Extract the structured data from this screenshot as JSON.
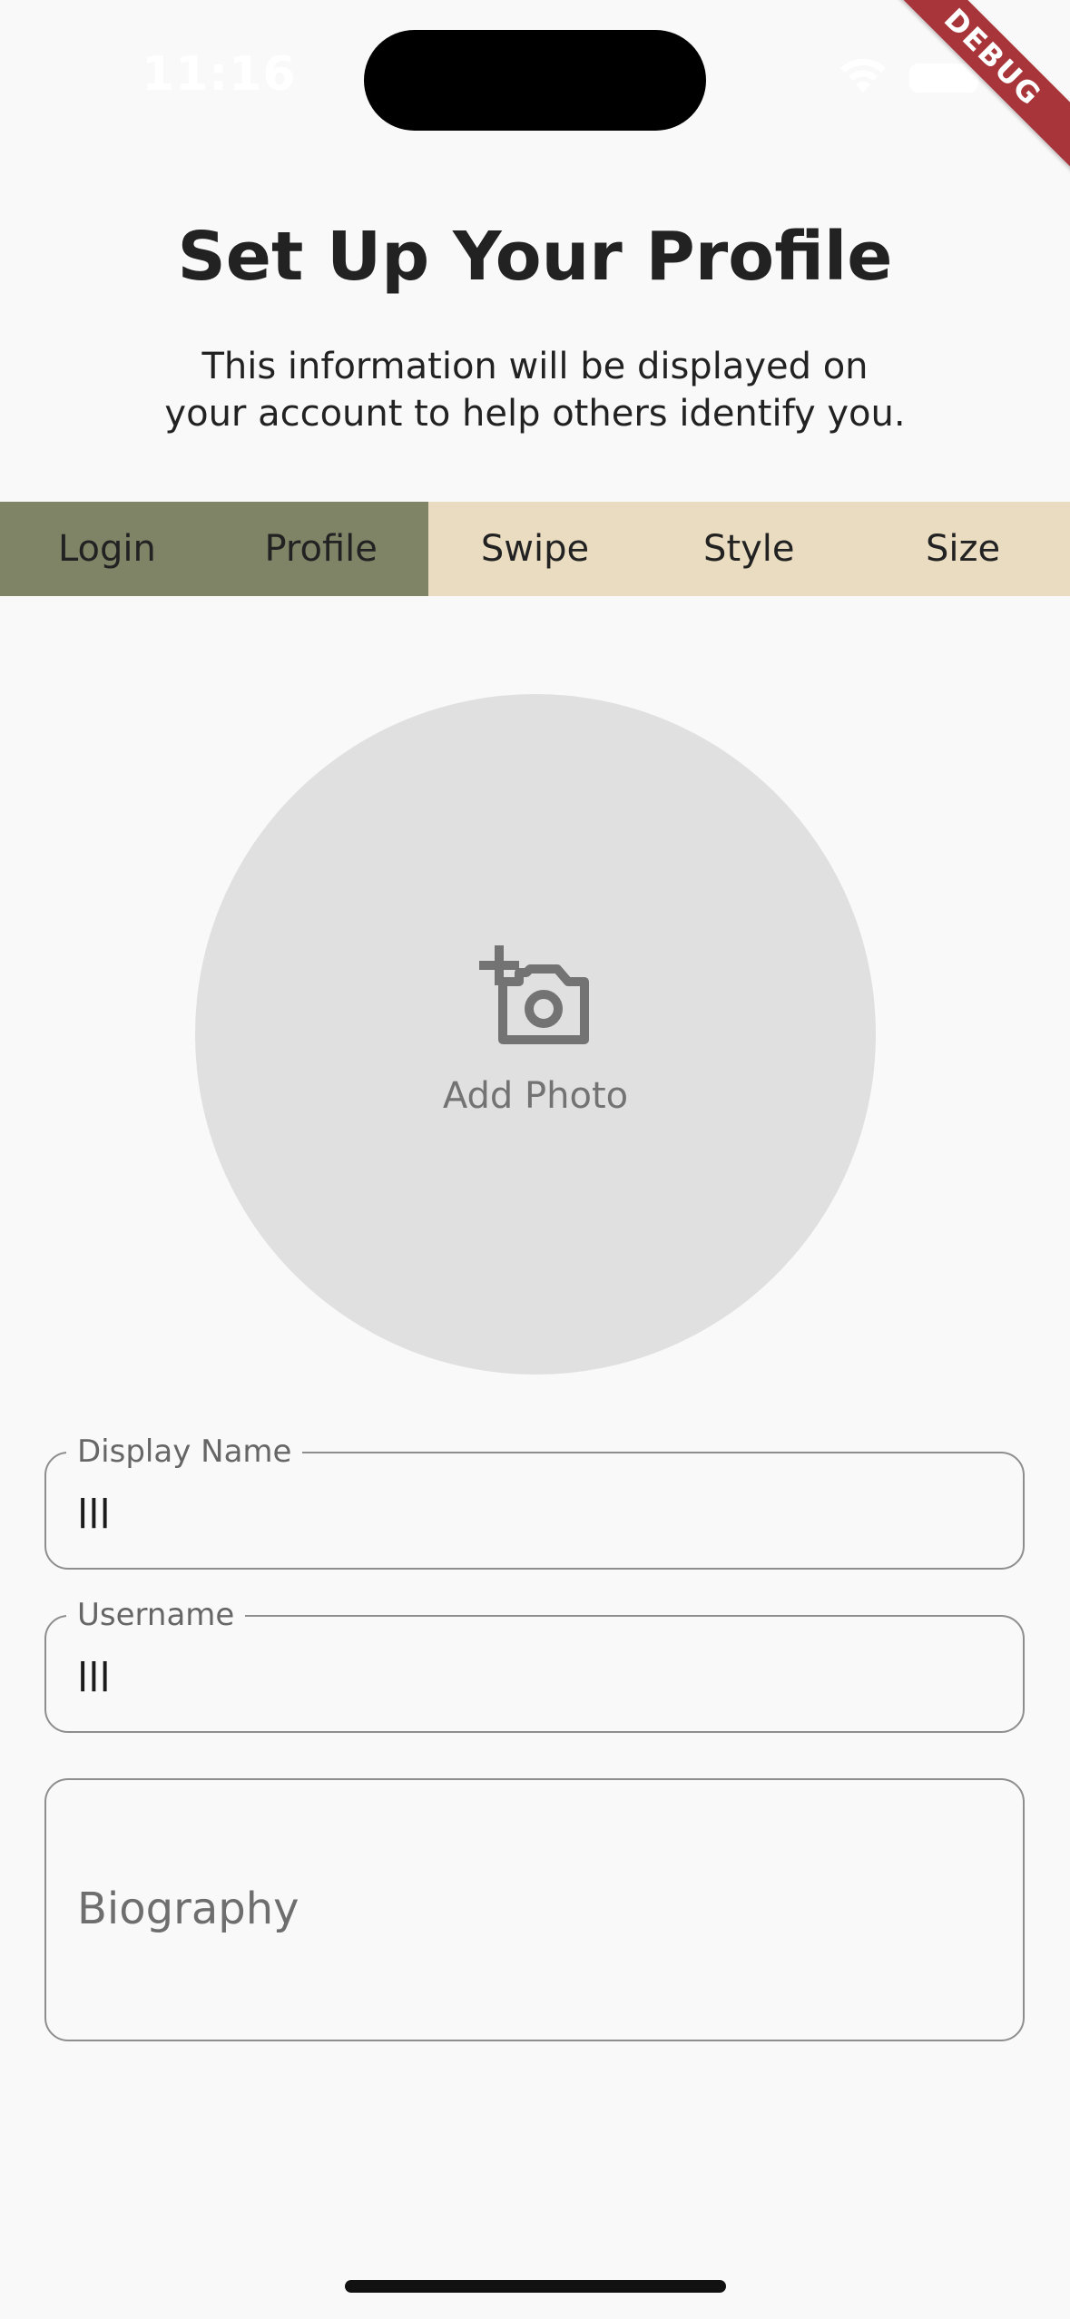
{
  "status_bar": {
    "time": "11:16"
  },
  "debug_banner": "DEBUG",
  "header": {
    "title": "Set Up Your Profile",
    "subtitle_line1": "This information will be displayed on",
    "subtitle_line2": "your account to help others identify you."
  },
  "tabs": [
    {
      "label": "Login",
      "completed": true
    },
    {
      "label": "Profile",
      "completed": true
    },
    {
      "label": "Swipe",
      "completed": false
    },
    {
      "label": "Style",
      "completed": false
    },
    {
      "label": "Size",
      "completed": false
    }
  ],
  "photo": {
    "icon": "add-a-photo-icon",
    "label": "Add Photo"
  },
  "fields": {
    "display_name": {
      "label": "Display Name",
      "value": "lll"
    },
    "username": {
      "label": "Username",
      "value": "lll"
    },
    "biography": {
      "placeholder": "Biography",
      "value": ""
    }
  },
  "colors": {
    "tab_completed": "#7f8467",
    "tab_pending": "#e9dcc0",
    "avatar_bg": "#e0e0e0",
    "debug_banner": "#a8353a"
  }
}
